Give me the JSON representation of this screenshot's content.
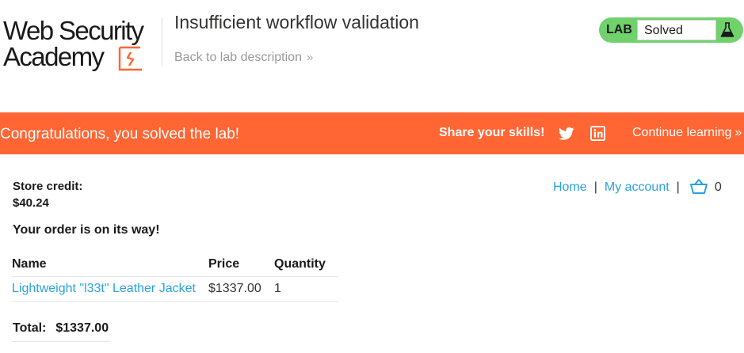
{
  "header": {
    "logo": {
      "line1": "Web Security",
      "line2": "Academy"
    },
    "title": "Insufficient workflow validation",
    "back_link": "Back to lab description",
    "back_chevron": "»"
  },
  "lab_status": {
    "label": "LAB",
    "status": "Solved",
    "icon": "flask-icon",
    "color": "#70d16d"
  },
  "notification": {
    "message": "Congratulations, you solved the lab!",
    "share": "Share your skills!",
    "continue": "Continue learning",
    "continue_chevron": "»",
    "color": "#ff6633"
  },
  "nav": {
    "home": "Home",
    "separator": "|",
    "account": "My account",
    "cart_count": "0"
  },
  "store": {
    "credit_label": "Store credit:",
    "credit_value": "$40.24"
  },
  "order": {
    "message": "Your order is on its way!",
    "columns": [
      "Name",
      "Price",
      "Quantity"
    ],
    "rows": [
      {
        "name": "Lightweight \"l33t\" Leather Jacket",
        "price": "$1337.00",
        "quantity": "1"
      }
    ],
    "total_label": "Total:",
    "total_value": "$1337.00"
  },
  "colors": {
    "link": "#29a3df",
    "accent": "#ff6633",
    "text": "#333332"
  }
}
